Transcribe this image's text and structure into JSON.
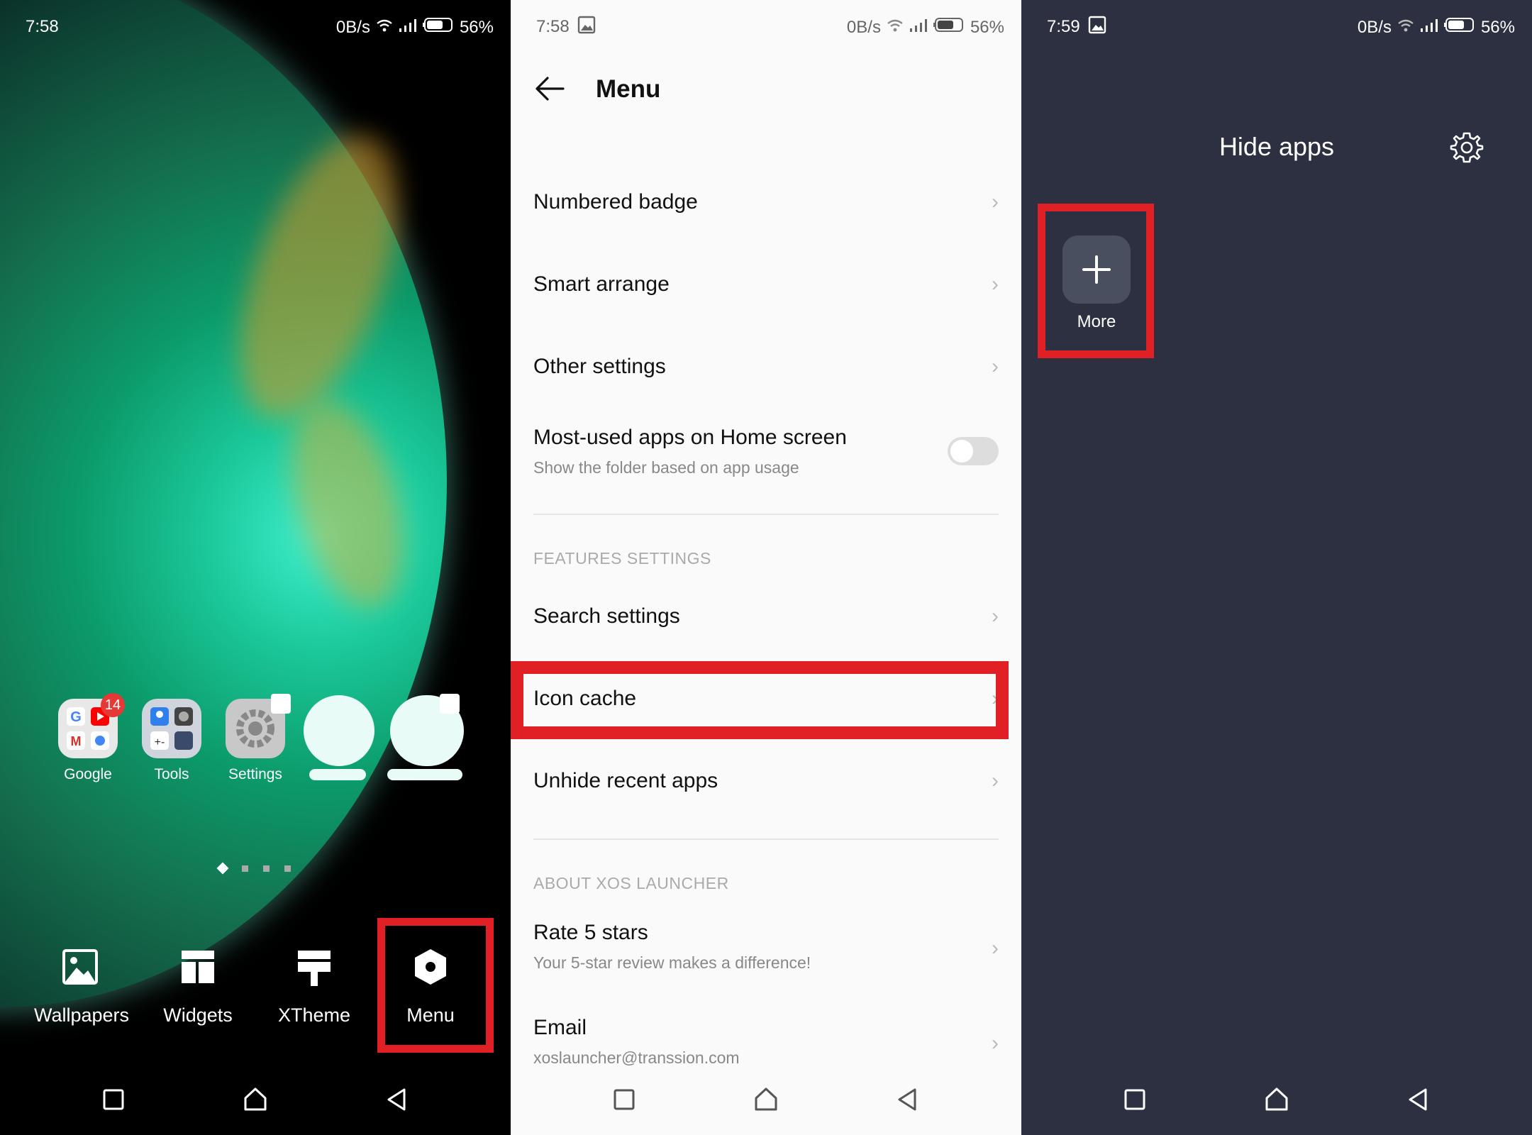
{
  "home": {
    "status": {
      "time": "7:58",
      "speed": "0B/s",
      "battery": "56%"
    },
    "apps": [
      {
        "label": "Google",
        "badge": "14"
      },
      {
        "label": "Tools"
      },
      {
        "label": "Settings"
      }
    ],
    "dock": [
      "Wallpapers",
      "Widgets",
      "XTheme",
      "Menu"
    ]
  },
  "menu": {
    "status": {
      "time": "7:58",
      "speed": "0B/s",
      "battery": "56%"
    },
    "title": "Menu",
    "items": {
      "numbered_badge": "Numbered badge",
      "smart_arrange": "Smart arrange",
      "other_settings": "Other settings",
      "most_used": "Most-used apps on Home screen",
      "most_used_sub": "Show the folder based on app usage",
      "features_header": "FEATURES SETTINGS",
      "search_settings": "Search settings",
      "icon_cache": "Icon cache",
      "unhide_recent": "Unhide recent apps",
      "about_header": "ABOUT XOS LAUNCHER",
      "rate": "Rate 5 stars",
      "rate_sub": "Your 5-star review makes a difference!",
      "email": "Email",
      "email_sub": "xoslauncher@transsion.com"
    },
    "toggle_on": false
  },
  "hide": {
    "status": {
      "time": "7:59",
      "speed": "0B/s",
      "battery": "56%"
    },
    "title": "Hide apps",
    "more_label": "More"
  },
  "colors": {
    "highlight": "#e02024",
    "dark_bg": "#2c3040"
  }
}
